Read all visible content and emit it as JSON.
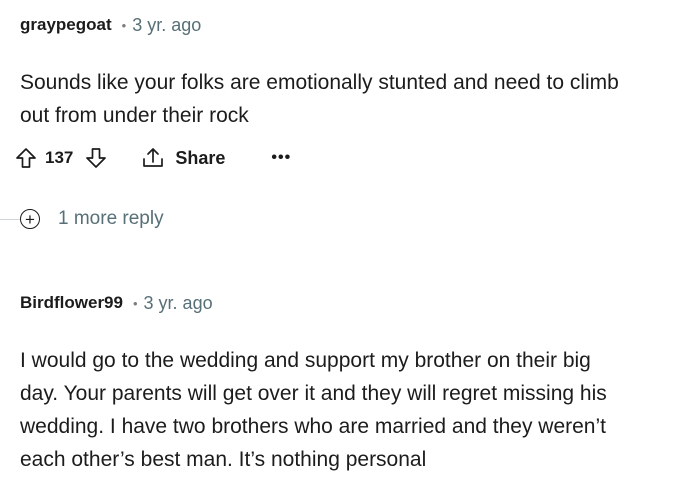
{
  "comments": [
    {
      "author": "graypegoat",
      "separator": "•",
      "time": "3 yr. ago",
      "lines": [
        "Sounds like your folks are emotionally stunted and need to climb",
        "out from under their rock"
      ],
      "score": "137",
      "share_label": "Share",
      "more_label": "•••",
      "icons": {
        "upvote": "arrow-up-outline-icon",
        "downvote": "arrow-down-outline-icon",
        "share": "share-upload-icon"
      },
      "more_replies": {
        "icon": "plus-circle-icon",
        "symbol": "+",
        "label": "1 more reply"
      }
    },
    {
      "author": "Birdflower99",
      "separator": "•",
      "time": "3 yr. ago",
      "lines": [
        "I would go to the wedding and support my brother on their big",
        "day. Your parents will get over it and they will regret missing his",
        "wedding. I have two brothers who are married and they weren’t",
        "each other’s best man. It’s nothing personal"
      ]
    }
  ],
  "colors": {
    "text": "#1c1c1c",
    "muted": "#576f76",
    "thread_line": "#cfd5d8"
  }
}
